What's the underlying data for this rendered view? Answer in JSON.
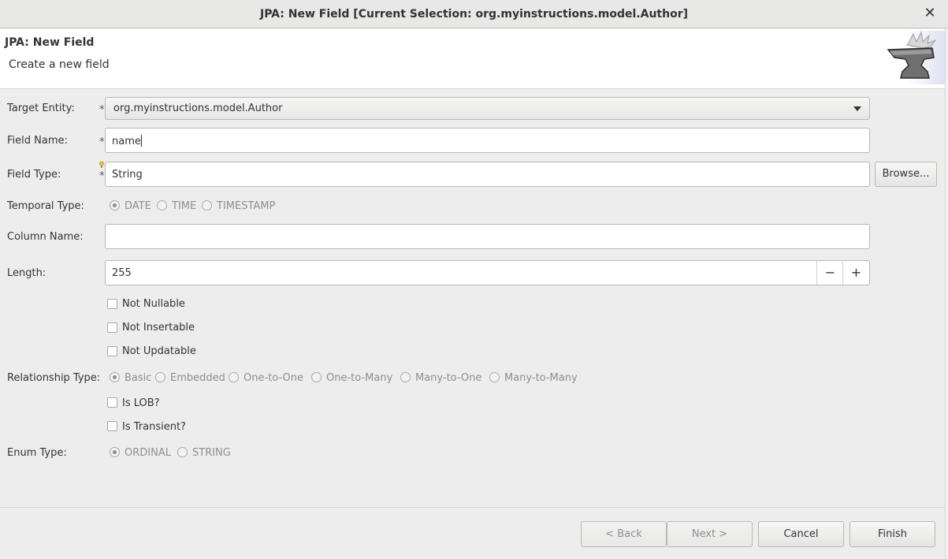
{
  "window": {
    "title": "JPA: New Field [Current Selection: org.myinstructions.model.Author]",
    "close_glyph": "✕"
  },
  "banner": {
    "title": "JPA: New Field",
    "description": "Create a new field",
    "icon": "anvil-icon"
  },
  "form": {
    "target_entity": {
      "label": "Target Entity:",
      "value": "org.myinstructions.model.Author"
    },
    "field_name": {
      "label": "Field Name:",
      "value": "name"
    },
    "field_type": {
      "label": "Field Type:",
      "value": "String",
      "browse_label": "Browse..."
    },
    "temporal_type": {
      "label": "Temporal Type:",
      "options": [
        "DATE",
        "TIME",
        "TIMESTAMP"
      ],
      "selected": "DATE"
    },
    "column_name": {
      "label": "Column Name:",
      "value": ""
    },
    "length": {
      "label": "Length:",
      "value": "255",
      "minus": "−",
      "plus": "+"
    },
    "checks_a": [
      {
        "label": "Not Nullable",
        "checked": false
      },
      {
        "label": "Not Insertable",
        "checked": false
      },
      {
        "label": "Not Updatable",
        "checked": false
      }
    ],
    "relationship_type": {
      "label": "Relationship Type:",
      "options": [
        "Basic",
        "Embedded",
        "One-to-One",
        "One-to-Many",
        "Many-to-One",
        "Many-to-Many"
      ],
      "selected": "Basic"
    },
    "checks_b": [
      {
        "label": "Is LOB?",
        "checked": false
      },
      {
        "label": "Is Transient?",
        "checked": false
      }
    ],
    "enum_type": {
      "label": "Enum Type:",
      "options": [
        "ORDINAL",
        "STRING"
      ],
      "selected": "ORDINAL"
    },
    "required_marker": "*"
  },
  "buttons": {
    "back": "< Back",
    "next": "Next >",
    "cancel": "Cancel",
    "finish": "Finish"
  }
}
